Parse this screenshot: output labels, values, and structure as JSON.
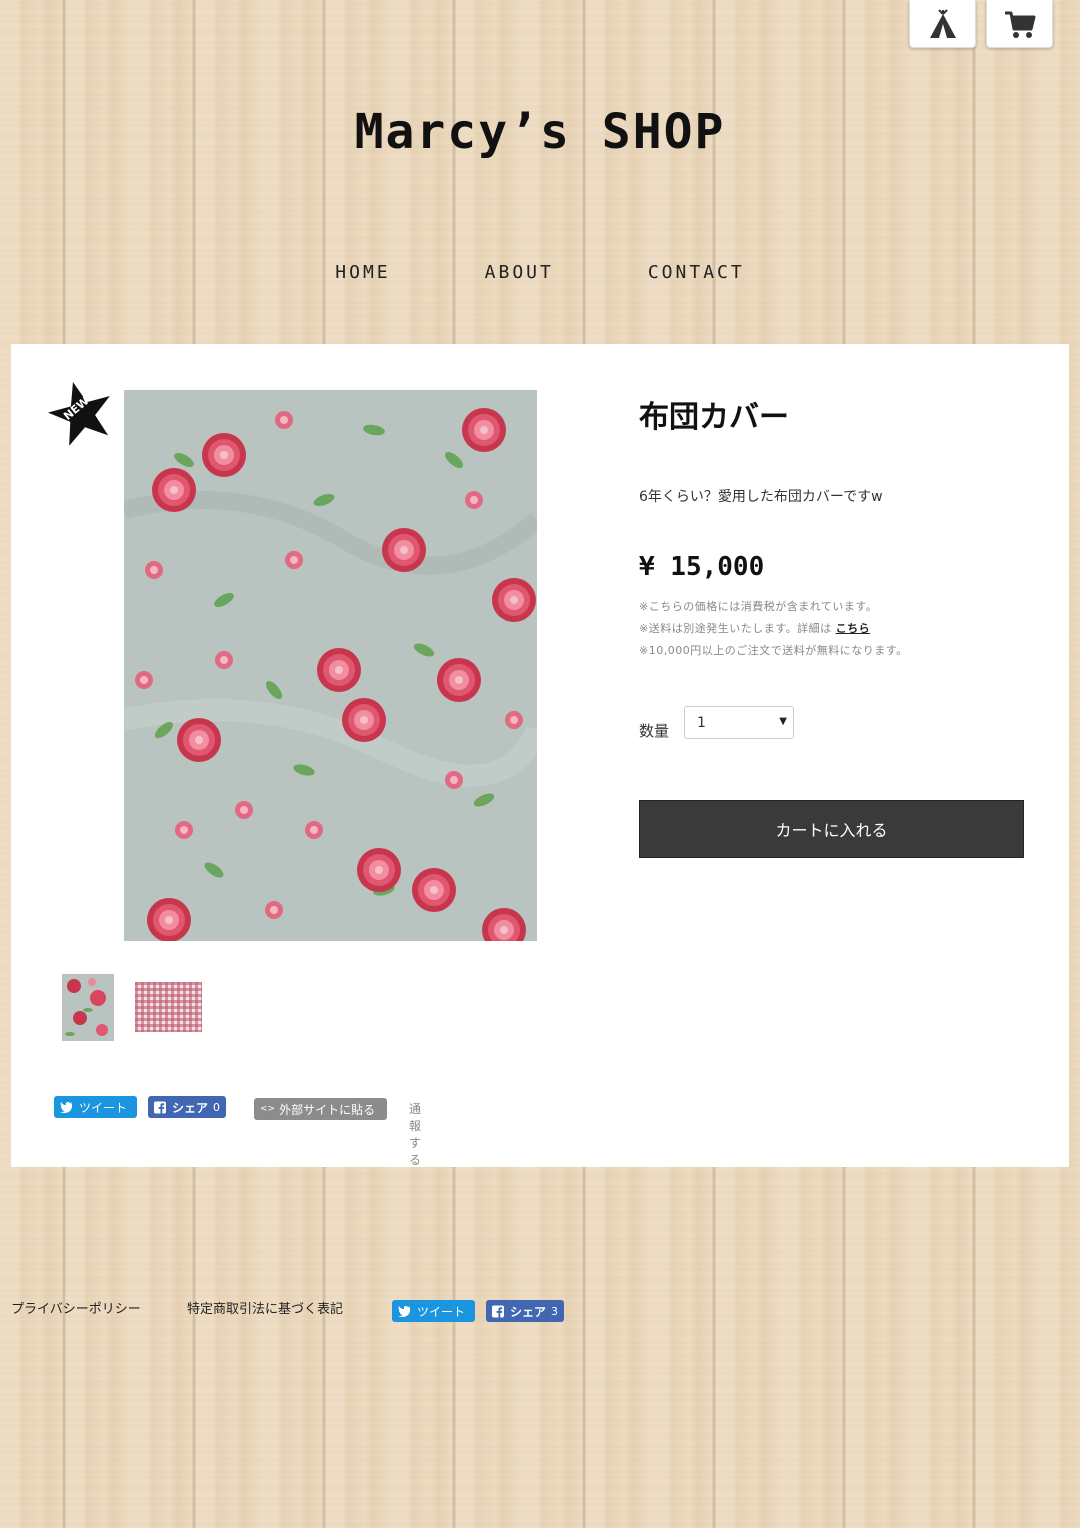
{
  "header": {
    "tent_icon": "tent-icon",
    "cart_icon": "cart-icon",
    "site_title": "Marcy’s SHOP"
  },
  "nav": {
    "items": [
      "HOME",
      "ABOUT",
      "CONTACT"
    ]
  },
  "product": {
    "badge": "NEW",
    "title": "布団カバー",
    "description": "6年くらい？愛用した布団カバーですw",
    "price": "¥ 15,000",
    "notes": {
      "tax": "※こちらの価格には消費税が含まれています。",
      "shipping_prefix": "※送料は別途発生いたします。詳細は",
      "shipping_link": "こちら",
      "free_shipping": "※10,000円以上のご注文で送料が無料になります。"
    },
    "quantity_label": "数量",
    "quantity_value": "1",
    "add_to_cart": "カートに入れる"
  },
  "share": {
    "tweet": "ツイート",
    "share": "シェア",
    "share_count": "0",
    "embed": "外部サイトに貼る",
    "report": "通報する"
  },
  "footer": {
    "privacy": "プライバシーポリシー",
    "legal": "特定商取引法に基づく表記",
    "tweet": "ツイート",
    "share": "シェア",
    "share_count": "3"
  },
  "colors": {
    "twitter": "#1b95e0",
    "facebook": "#4267b2",
    "cart_button": "#3a3a3a"
  }
}
